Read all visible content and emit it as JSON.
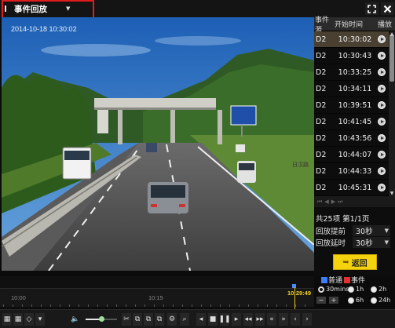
{
  "topbar": {
    "title": "事件回放",
    "dropdown_icon": "chevron-down-icon",
    "fullscreen_icon": "fullscreen-icon",
    "close_icon": "close-icon"
  },
  "events": {
    "headers": {
      "source": "事件源",
      "start_time": "开始时间",
      "play": "播放"
    },
    "rows": [
      {
        "source": "D2",
        "time": "10:30:02",
        "selected": true
      },
      {
        "source": "D2",
        "time": "10:30:43"
      },
      {
        "source": "D2",
        "time": "10:33:25"
      },
      {
        "source": "D2",
        "time": "10:34:11"
      },
      {
        "source": "D2",
        "time": "10:39:51"
      },
      {
        "source": "D2",
        "time": "10:41:45"
      },
      {
        "source": "D2",
        "time": "10:43:56"
      },
      {
        "source": "D2",
        "time": "10:44:07"
      },
      {
        "source": "D2",
        "time": "10:44:33"
      },
      {
        "source": "D2",
        "time": "10:45:31"
      }
    ]
  },
  "page_info": "共25项 第1/1页",
  "settings": {
    "pre_label": "回放提前",
    "pre_value": "30秒",
    "post_label": "回放延时",
    "post_value": "30秒"
  },
  "back_button": "返回",
  "timeline": {
    "labels": [
      "10:00",
      "10:15"
    ],
    "cursor_time": "10:29:49"
  },
  "legend": {
    "normal": "普通",
    "event": "事件",
    "normal_color": "#3e7bff",
    "event_color": "#e63030"
  },
  "zoom": {
    "options": [
      "30mins",
      "1h",
      "2h",
      "6h",
      "24h"
    ],
    "selected": "30mins",
    "minus": "−",
    "plus": "+"
  },
  "video": {
    "road_sign": "日汉路"
  },
  "playback": {
    "volume": 0.5
  }
}
